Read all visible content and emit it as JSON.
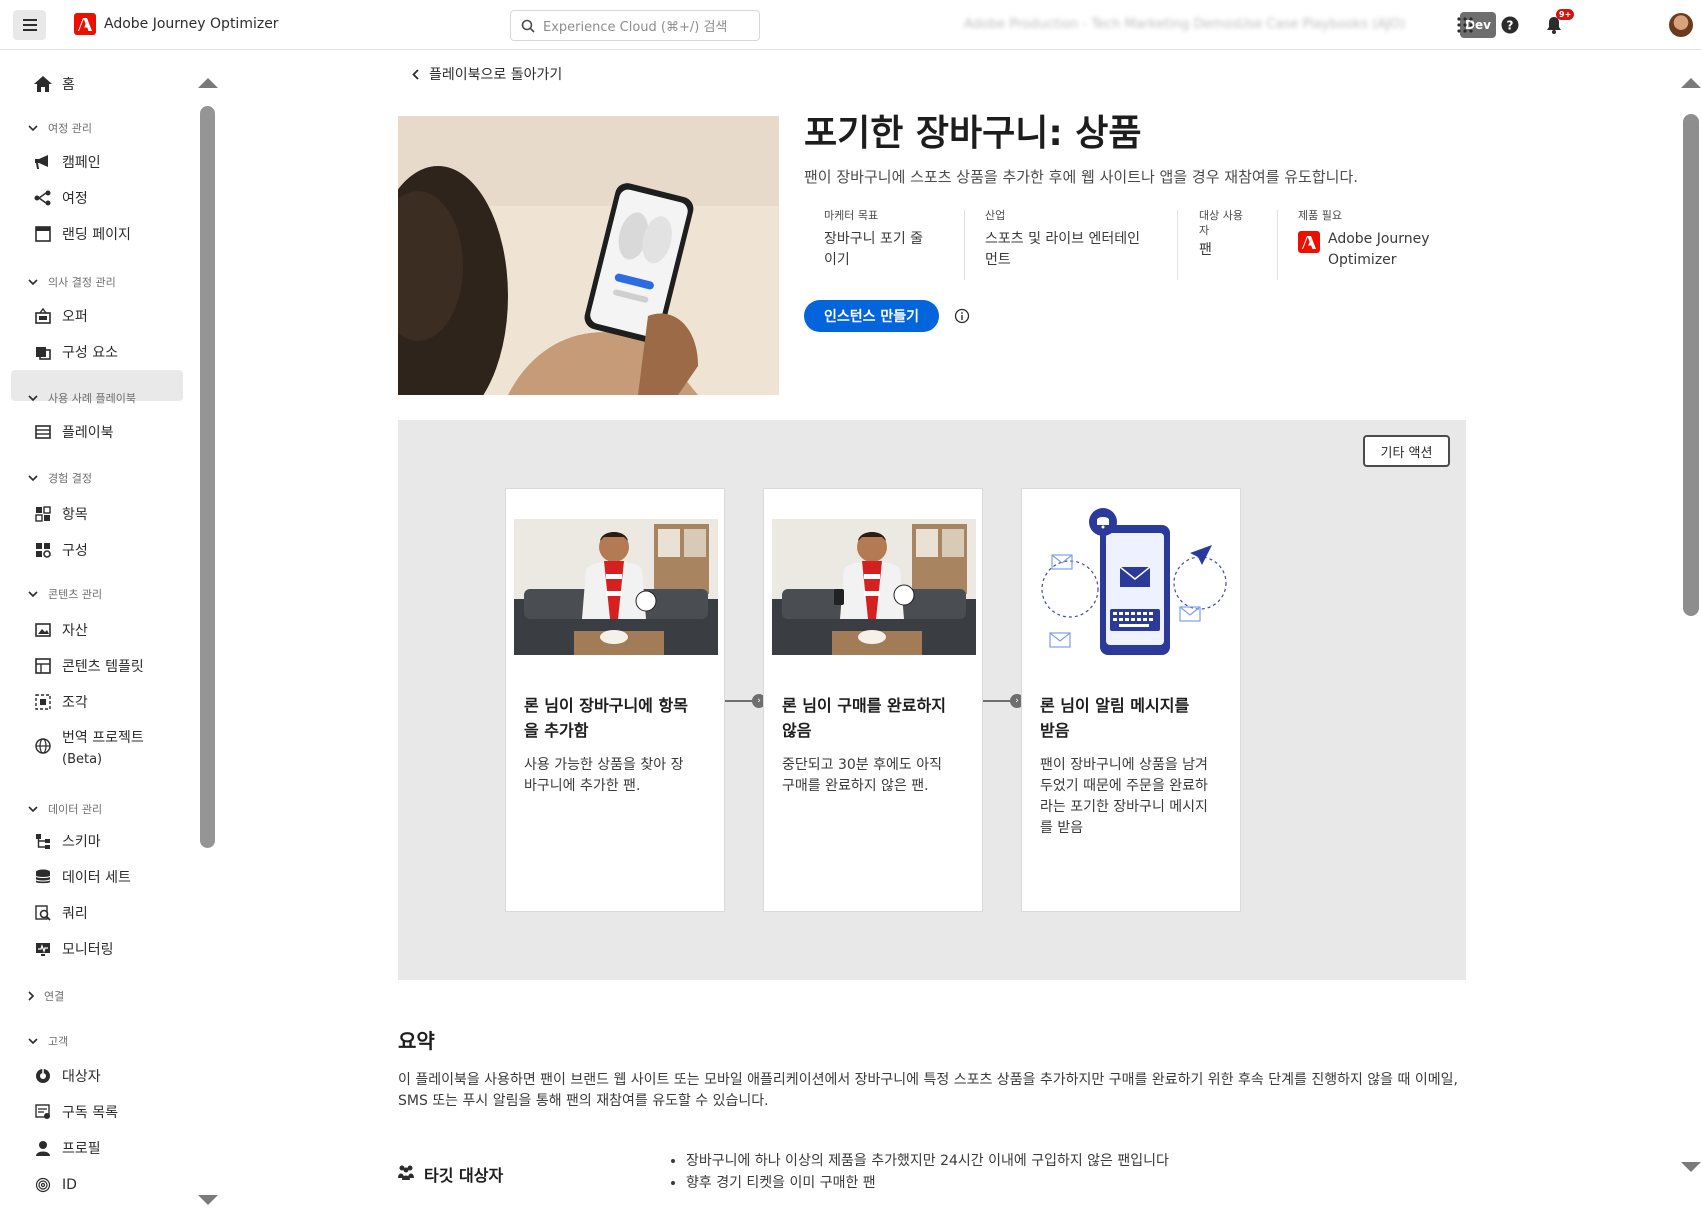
{
  "header": {
    "app_name": "Adobe Journey Optimizer",
    "search_placeholder": "Experience Cloud (⌘+/) 검색",
    "org_name": "Adobe Production - Tech Marketing Demos",
    "sandbox_name": "Use Case Playbooks (AJO)",
    "env_badge": "Dev",
    "notification_count": "9+"
  },
  "sidebar": {
    "home": "홈",
    "sections": [
      {
        "label": "여정 관리",
        "items": [
          "캠페인",
          "여정",
          "랜딩 페이지"
        ]
      },
      {
        "label": "의사 결정 관리",
        "items": [
          "오퍼",
          "구성 요소"
        ]
      },
      {
        "label": "사용 사례 플레이북",
        "items": [
          "플레이북"
        ]
      },
      {
        "label": "경험 결정",
        "items": [
          "항목",
          "구성"
        ]
      },
      {
        "label": "콘텐츠 관리",
        "items": [
          "자산",
          "콘텐츠 템플릿",
          "조각",
          "번역 프로젝트",
          "(Beta)"
        ]
      },
      {
        "label": "데이터 관리",
        "items": [
          "스키마",
          "데이터 세트",
          "쿼리",
          "모니터링"
        ]
      },
      {
        "label": "연결",
        "items": []
      },
      {
        "label": "고객",
        "items": [
          "대상자",
          "구독 목록",
          "프로필",
          "ID"
        ]
      }
    ]
  },
  "main": {
    "back_link": "플레이북으로 돌아가기",
    "title": "포기한 장바구니: 상품",
    "subtitle": "팬이 장바구니에 스포츠 상품을 추가한 후에 웹 사이트나 앱을 경우 재참여를 유도합니다.",
    "meta": {
      "goal_label": "마케터 목표",
      "goal_value_1": "장바구니 포기 줄",
      "goal_value_2": "이기",
      "industry_label": "산업",
      "industry_value_1": "스포츠 및 라이브 엔터테인",
      "industry_value_2": "먼트",
      "audience_label_1": "대상 사용",
      "audience_label_2": "자",
      "audience_value": "팬",
      "product_label": "제품 필요",
      "product_value_1": "Adobe Journey",
      "product_value_2": "Optimizer"
    },
    "create_button": "인스턴스 만들기",
    "other_actions": "기타 액션",
    "cards": [
      {
        "title_1": "론 님이 장바구니에 항목",
        "title_2": "을 추가함",
        "desc": [
          "사용 가능한 상품을 찾아 장",
          "바구니에 추가한 팬."
        ]
      },
      {
        "title_1": "론 님이 구매를 완료하지",
        "title_2": "않음",
        "desc": [
          "중단되고 30분 후에도 아직",
          "구매를 완료하지 않은 팬."
        ]
      },
      {
        "title_1": "론 님이 알림 메시지를",
        "title_2": "받음",
        "desc": [
          "팬이 장바구니에 상품을 남겨",
          "두었기 때문에 주문을 완료하",
          "라는 포기한 장바구니 메시지",
          "를 받음"
        ]
      }
    ],
    "summary_title": "요약",
    "summary_text": "이 플레이북을 사용하면 팬이 브랜드 웹 사이트 또는 모바일 애플리케이션에서 장바구니에 특정 스포츠 상품을 추가하지만 구매를 완료하기 위한 후속 단계를 진행하지 않을 때 이메일, SMS 또는 푸시 알림을 통해 팬의 재참여를 유도할 수 있습니다.",
    "target_title": "타깃 대상자",
    "target_items": [
      "장바구니에 하나 이상의 제품을 추가했지만 24시간 이내에 구입하지 않은 팬입니다",
      "향후 경기 티켓을 이미 구매한 팬"
    ]
  },
  "colors": {
    "accent": "#0265dc",
    "brand": "#eb1000",
    "panel": "#e8e8e8"
  }
}
